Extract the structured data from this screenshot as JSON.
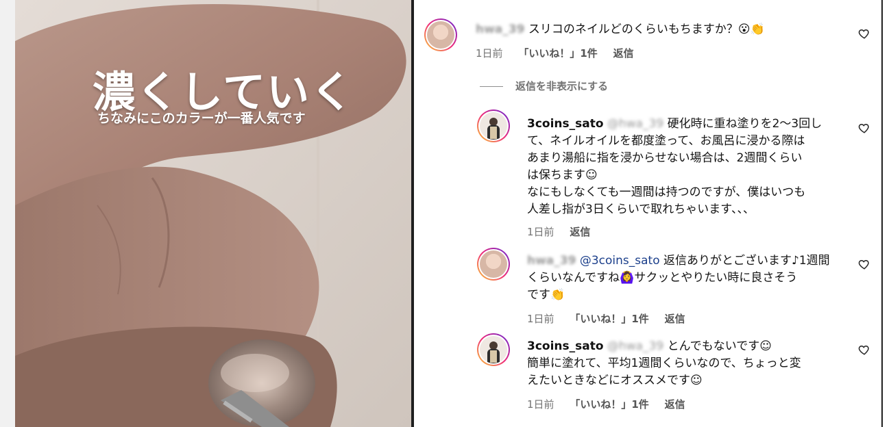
{
  "video": {
    "title": "濃くしていく",
    "subtitle": "ちなみにこのカラーが一番人気です"
  },
  "comments": [
    {
      "user": "hwa_39",
      "text": "スリコのネイルどのくらいもちますか？",
      "emojis": "😮👏",
      "time": "1日前",
      "likes": "「いいね！」1件",
      "reply": "返信",
      "hide_replies": "返信を非表示にする"
    },
    {
      "user": "3coins_sato",
      "mention": "@hwa_39",
      "lines": [
        "硬化時に重ね塗りを2〜3回し",
        "て、ネイルオイルを都度塗って、お風呂に浸かる際は",
        "あまり湯船に指を浸からせない場合は、2週間くらい",
        "は保ちます☺",
        "なにもしなくても一週間は持つのですが、僕はいつも",
        "人差し指が3日くらいで取れちゃいます、、、"
      ],
      "time": "1日前",
      "reply": "返信"
    },
    {
      "user": "hwa_39",
      "mention": "@3coins_sato",
      "lines": [
        "返信ありがとございます♪1週間",
        "くらいなんですね🙆‍♀️サクッとやりたい時に良さそう",
        "です👏"
      ],
      "time": "1日前",
      "likes": "「いいね！」1件",
      "reply": "返信"
    },
    {
      "user": "3coins_sato",
      "mention": "@hwa_39",
      "lines": [
        "とんでもないです☺",
        "簡単に塗れて、平均1週間くらいなので、ちょっと変",
        "えたいときなどにオススメです☺"
      ],
      "time": "1日前",
      "likes": "「いいね！」1件",
      "reply": "返信"
    }
  ],
  "icons": {
    "like": "heart-outline-icon"
  },
  "colors": {
    "mention": "#1b3f8b",
    "meta": "#737373",
    "avatar_ring_start": "#f9ce34",
    "avatar_ring_mid": "#ee2a7b",
    "avatar_ring_end": "#6228d7"
  }
}
